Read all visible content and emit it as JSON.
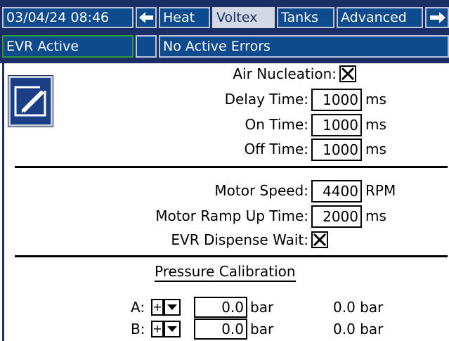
{
  "header": {
    "datetime": "03/04/24 08:46",
    "nav_left_icon": "arrow-left",
    "nav_right_icon": "arrow-right",
    "tabs": [
      {
        "label": "Heat",
        "active": false
      },
      {
        "label": "Voltex",
        "active": true
      },
      {
        "label": "Tanks",
        "active": false
      },
      {
        "label": "Advanced",
        "active": false
      }
    ]
  },
  "status": {
    "mode": "EVR Active",
    "errors": "No Active Errors"
  },
  "colors": {
    "bar_background": "#1b2f66",
    "cell_blue": "#0e4a8e",
    "active_tab": "#d2d8e3",
    "mode_border": "#2f9a3a"
  },
  "edit_button": {
    "icon": "edit-pencil-icon"
  },
  "air": {
    "nucleation_label": "Air Nucleation:",
    "nucleation_checked": true,
    "delay_label": "Delay Time:",
    "delay_value": "1000",
    "delay_unit": "ms",
    "on_label": "On Time:",
    "on_value": "1000",
    "on_unit": "ms",
    "off_label": "Off Time:",
    "off_value": "1000",
    "off_unit": "ms"
  },
  "motor": {
    "speed_label": "Motor Speed:",
    "speed_value": "4400",
    "speed_unit": "RPM",
    "ramp_label": "Motor Ramp Up Time:",
    "ramp_value": "2000",
    "ramp_unit": "ms",
    "evr_wait_label": "EVR Dispense Wait:",
    "evr_wait_checked": true
  },
  "pressure": {
    "title": "Pressure Calibration",
    "rows": [
      {
        "label": "A:",
        "sign": "+",
        "value": "0.0",
        "unit": "bar",
        "reading": "0.0 bar"
      },
      {
        "label": "B:",
        "sign": "+",
        "value": "0.0",
        "unit": "bar",
        "reading": "0.0 bar"
      }
    ]
  }
}
